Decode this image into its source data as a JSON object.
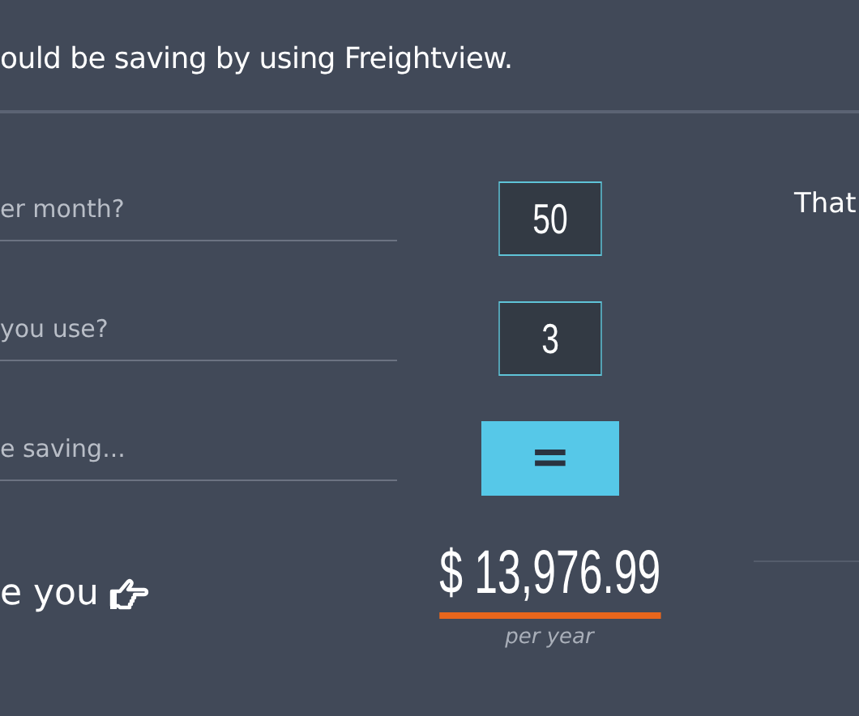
{
  "header": {
    "text": "ould be saving by using Freightview."
  },
  "questions": [
    {
      "label": "er month?",
      "value": "50"
    },
    {
      "label": "you use?",
      "value": "3"
    }
  ],
  "result_row": {
    "label": "e saving...",
    "button": "="
  },
  "cta": {
    "text": "e you"
  },
  "savings": {
    "amount": "$ 13,976.99",
    "period": "per year"
  },
  "side": {
    "text": "That"
  }
}
